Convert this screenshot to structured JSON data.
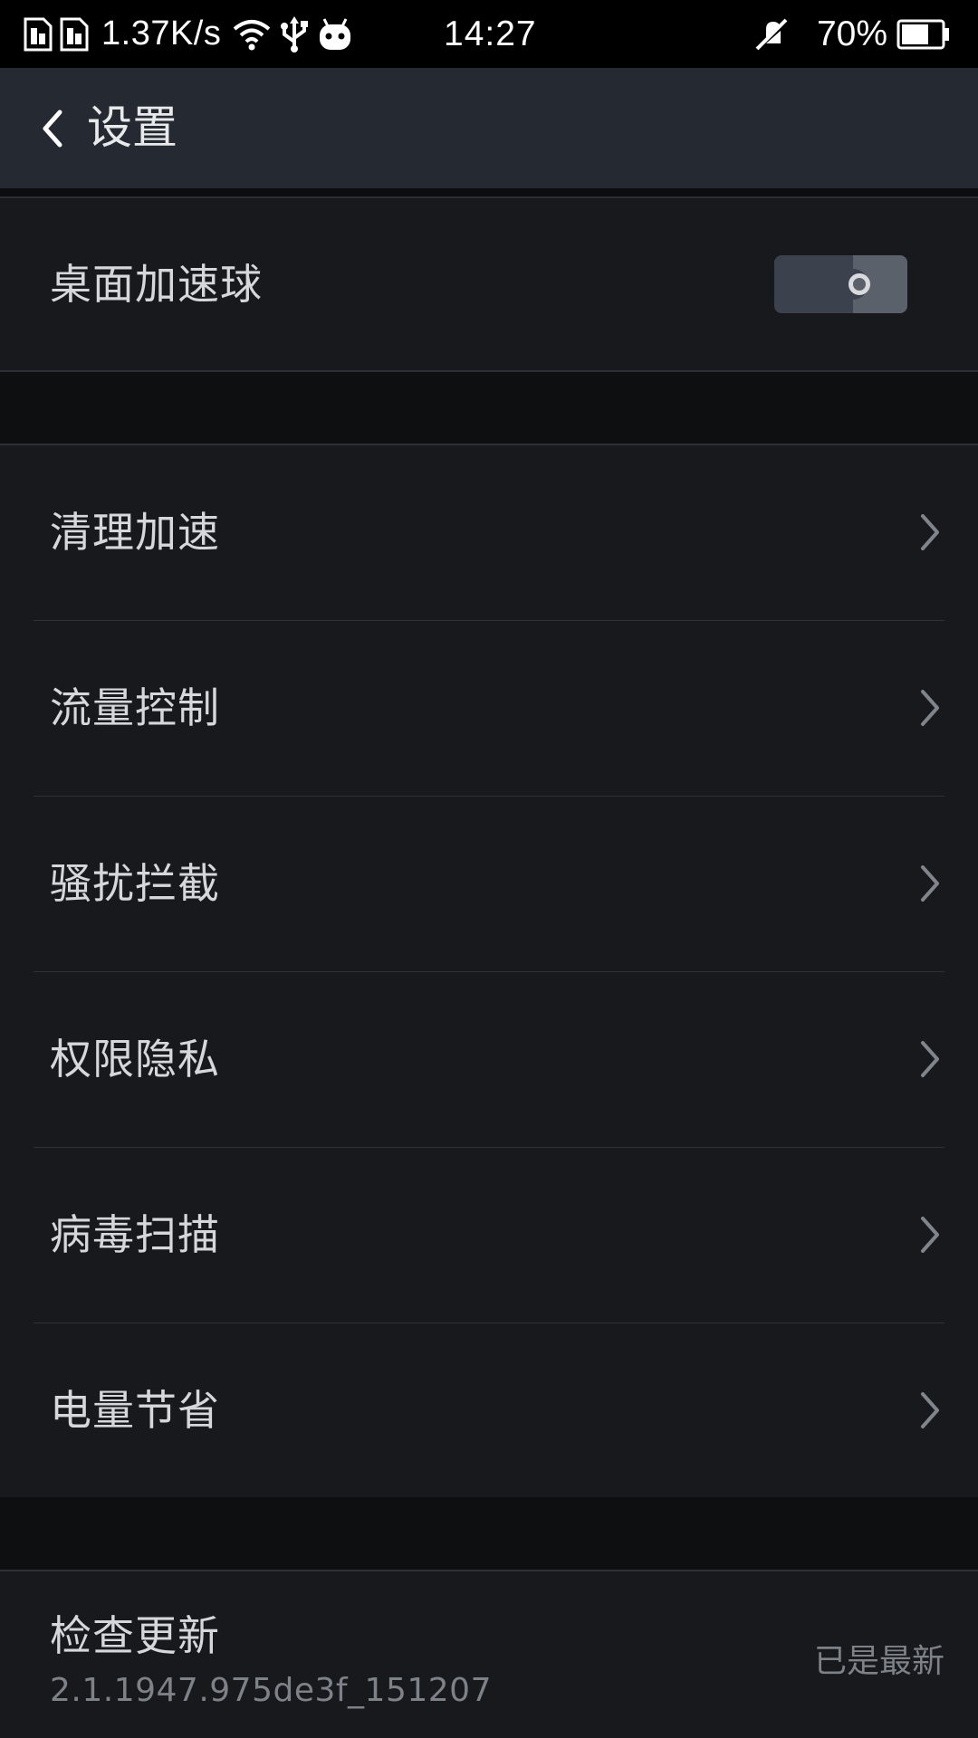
{
  "status_bar": {
    "net_speed": "1.37K/s",
    "time": "14:27",
    "battery_percent": "70%",
    "battery_level": 0.7,
    "icons": [
      "sim-card-icon",
      "sim-card-icon",
      "wifi-icon",
      "usb-icon",
      "android-icon",
      "mute-icon",
      "battery-icon"
    ]
  },
  "header": {
    "title": "设置"
  },
  "toggle_row": {
    "label": "桌面加速球",
    "enabled": false
  },
  "menu": {
    "items": [
      {
        "label": "清理加速"
      },
      {
        "label": "流量控制"
      },
      {
        "label": "骚扰拦截"
      },
      {
        "label": "权限隐私"
      },
      {
        "label": "病毒扫描"
      },
      {
        "label": "电量节省"
      }
    ]
  },
  "update": {
    "label": "检查更新",
    "version": "2.1.1947.975de3f_151207",
    "status": "已是最新"
  },
  "colors": {
    "background": "#17191d",
    "app_bar": "#252a32",
    "section_gap": "#0e0f11",
    "text_primary": "#d5d7da",
    "text_secondary": "#7d8188"
  }
}
